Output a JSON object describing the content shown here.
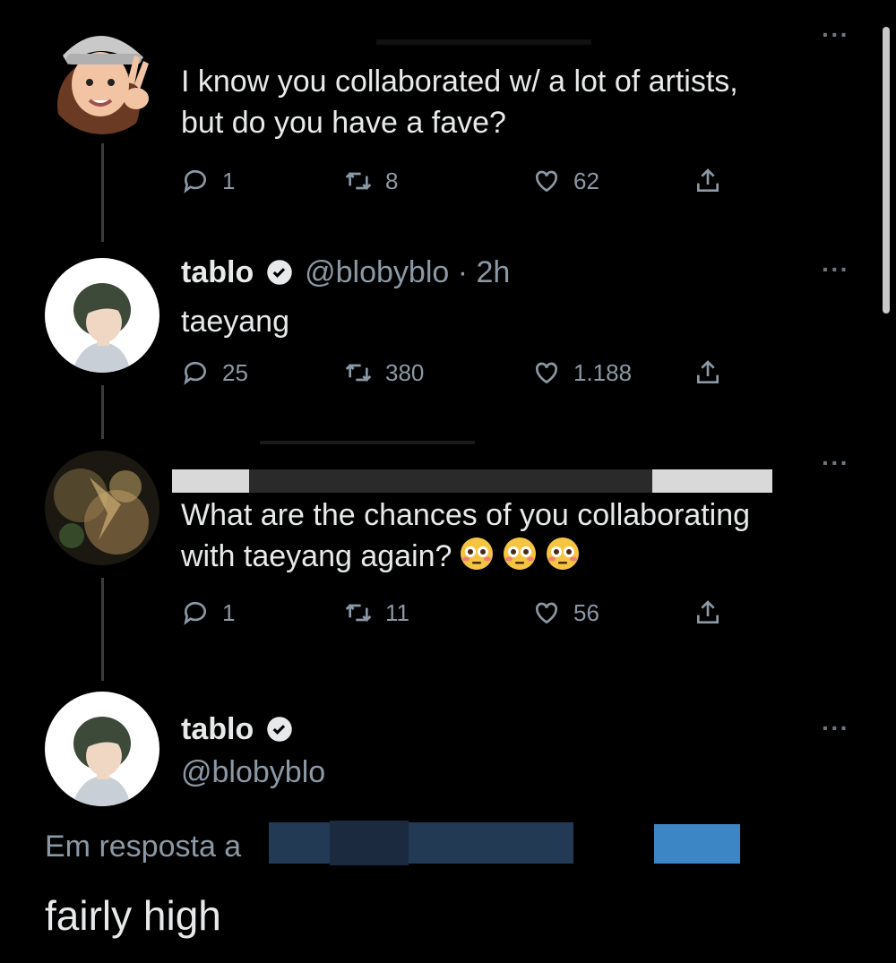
{
  "tweets": [
    {
      "text_lines": [
        "I know you collaborated w/ a lot of artists,",
        "but do you have a fave?"
      ],
      "replies": "1",
      "retweets": "8",
      "likes": "62"
    },
    {
      "name": "tablo",
      "handle": "@blobyblo",
      "time": "· 2h",
      "text": "taeyang",
      "replies": "25",
      "retweets": "380",
      "likes": "1.188"
    },
    {
      "text_lines": [
        "What are the chances of you collaborating",
        "with taeyang again?"
      ],
      "replies": "1",
      "retweets": "11",
      "likes": "56"
    },
    {
      "name": "tablo",
      "handle": "@blobyblo",
      "reply_prefix": "Em resposta a",
      "text": "fairly high"
    }
  ],
  "icons": {
    "reply": "reply-icon",
    "retweet": "retweet-icon",
    "like": "heart-icon",
    "share": "share-icon",
    "more": "more-icon",
    "verified": "verified-badge-icon",
    "emoji": "flushed-face-emoji"
  },
  "colors": {
    "background": "#000000",
    "text": "#e7e9ea",
    "muted": "#8b98a5",
    "thread": "#3a3b3c"
  }
}
